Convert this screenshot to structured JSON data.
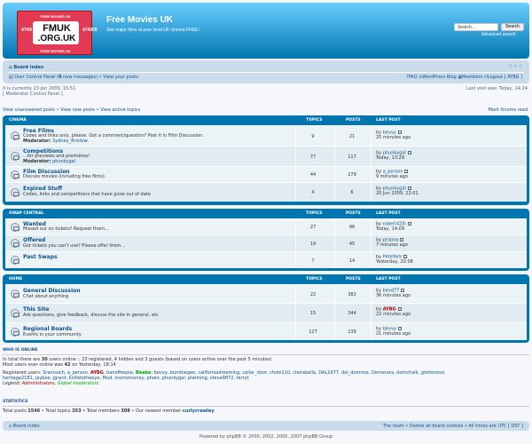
{
  "header": {
    "logo_top": "FREE MOVIES UK",
    "logo_line1": "FMUK",
    "logo_line2": ".ORG.UK",
    "logo_bottom": "FREE MOVIES UK",
    "logo_side_left": "474005",
    "logo_side_right": "474005",
    "title": "Free Movies UK",
    "description": "See major films at your local UK cinema FREE!",
    "search_placeholder": "Search…",
    "search_button": "Search",
    "advanced_search": "Advanced search"
  },
  "navbar": {
    "board_index": "Board index",
    "ucp": "User Control Panel",
    "new_messages_count": "0",
    "new_messages": "new messages",
    "view_posts": "View your posts",
    "faq": "FAQ",
    "blog": "WordPress Blog",
    "members": "Members",
    "logout": "Logout [ AYBG ]",
    "font_size": "A A A"
  },
  "info": {
    "current_time": "It is currently 23 Jun 2009, 15:51",
    "mcp": "[ Moderator Control Panel ]",
    "last_visit": "Last visit was: Today, 14:24"
  },
  "quick_links": {
    "unanswered": "View unanswered posts",
    "new": "View new posts",
    "active": "View active topics",
    "mark_read": "Mark forums read"
  },
  "columns": {
    "topics": "TOPICS",
    "posts": "POSTS",
    "last_post": "LAST POST"
  },
  "categories": [
    {
      "name": "CINEMA",
      "forums": [
        {
          "title": "Free Films",
          "desc": "Codes and links only, please. Got a comment/question? Post it in Film Discussion.",
          "moderator_label": "Moderator:",
          "moderator": "Sydney_Bristow",
          "topics": "9",
          "posts": "21",
          "by": "by",
          "user": "bevvy",
          "time": "25 minutes ago"
        },
        {
          "title": "Competitions",
          "desc": "...for previews and premières!",
          "moderator_label": "Moderator:",
          "moderator": "phunkygal",
          "topics": "77",
          "posts": "117",
          "by": "by",
          "user": "phunkygal",
          "time": "Today, 13:29"
        },
        {
          "title": "Film Discussion",
          "desc": "Discuss movies (including free films)",
          "topics": "44",
          "posts": "279",
          "by": "by",
          "user": "a_person",
          "time": "9 minutes ago"
        },
        {
          "title": "Expired Stuff",
          "desc": "Codes, links and competitions that have gone out of date",
          "topics": "4",
          "posts": "6",
          "by": "by",
          "user": "phunkygal",
          "time": "20 Jun 2009, 22:01"
        }
      ]
    },
    {
      "name": "SWAP CENTRAL",
      "forums": [
        {
          "title": "Wanted",
          "desc": "Missed out on tickets? Request them...",
          "topics": "27",
          "posts": "96",
          "by": "by",
          "user": "robert42jh",
          "time": "Today, 14:09"
        },
        {
          "title": "Offered",
          "desc": "Got tickets you can't use? Please offer them...",
          "topics": "19",
          "posts": "45",
          "by": "by",
          "user": "priama",
          "time": "7 minutes ago"
        },
        {
          "title": "Past Swaps",
          "desc": "",
          "topics": "7",
          "posts": "14",
          "by": "by",
          "user": "PeteYork",
          "time": "Yesterday, 20:08"
        }
      ]
    },
    {
      "name": "HOME",
      "forums": [
        {
          "title": "General Discussion",
          "desc": "Chat about anything",
          "topics": "22",
          "posts": "382",
          "by": "by",
          "user": "bevd77",
          "time": "36 minutes ago"
        },
        {
          "title": "This Site",
          "desc": "Ask questions, give feedback, discuss the site in general, etc",
          "topics": "15",
          "posts": "344",
          "by": "by",
          "user": "AYBG",
          "time": "22 minutes ago"
        },
        {
          "title": "Regional Boards",
          "desc": "Events in your community",
          "topics": "127",
          "posts": "239",
          "by": "by",
          "user": "bevvy",
          "time": "21 minutes ago"
        }
      ]
    }
  ],
  "who_online": {
    "heading": "WHO IS ONLINE",
    "line1_a": "In total there are",
    "total": "30",
    "line1_b": "users online :: 23 registered, 4 hidden and 3 guests (based on users active over the past 5 minutes)",
    "line2_a": "Most users ever online was",
    "most": "42",
    "line2_b": "on Yesterday, 18:14",
    "registered_label": "Registered users:",
    "users_a": "Sramsoch, a_person,",
    "user_admin": "AYBG",
    "users_b": ", banoffeepie,",
    "user_mod": "Beabe",
    "users_c": ", bevvy, bumblegee, californiadreaming, cellar_door, chole110, clairabella, DAL1977, del_dommie, Demerara, domchalk, giottorossi,",
    "users_d": "heritage2181, jaybee, jgrant, knifetotheeye, Mud, momomoney, phatz, phunkygal, platining, steve9872, terryt",
    "legend_label": "Legend:",
    "legend_admin": "Administrators",
    "legend_mod": "Global moderators"
  },
  "statistics": {
    "heading": "STATISTICS",
    "posts_label": "Total posts",
    "posts": "1546",
    "topics_label": "Total topics",
    "topics": "353",
    "members_label": "Total members",
    "members": "308",
    "newest_label": "Our newest member",
    "newest": "curlycrawley"
  },
  "footer": {
    "board_index": "Board index",
    "team": "The team",
    "delete_cookies": "Delete all board cookies",
    "timezone": "All times are UTC [",
    "dst": "DST",
    "timezone_end": "]",
    "powered": "Powered by phpBB © 2000, 2002, 2005, 2007 phpBB Group"
  }
}
